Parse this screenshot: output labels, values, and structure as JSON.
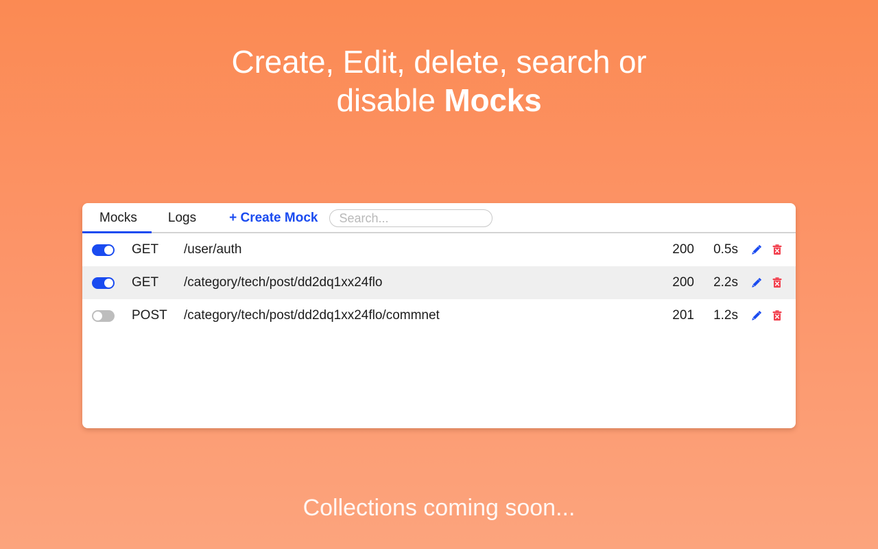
{
  "hero": {
    "line1": "Create, Edit, delete, search or",
    "line2_prefix": "disable ",
    "line2_strong": "Mocks"
  },
  "card": {
    "tabs": [
      {
        "label": "Mocks",
        "active": true
      },
      {
        "label": "Logs",
        "active": false
      }
    ],
    "create_label": "+ Create Mock",
    "search": {
      "placeholder": "Search...",
      "value": ""
    },
    "rows": [
      {
        "enabled": true,
        "method": "GET",
        "path": "/user/auth",
        "status": "200",
        "latency": "0.5s",
        "edit_icon": "pencil-icon",
        "delete_icon": "trash-icon"
      },
      {
        "enabled": true,
        "method": "GET",
        "path": "/category/tech/post/dd2dq1xx24flo",
        "status": "200",
        "latency": "2.2s",
        "edit_icon": "pencil-icon",
        "delete_icon": "trash-icon"
      },
      {
        "enabled": false,
        "method": "POST",
        "path": "/category/tech/post/dd2dq1xx24flo/commnet",
        "status": "201",
        "latency": "1.2s",
        "edit_icon": "pencil-icon",
        "delete_icon": "trash-icon"
      }
    ]
  },
  "footer": {
    "text": "Collections coming soon..."
  },
  "colors": {
    "background_top": "#FB8A53",
    "background_bottom": "#FCA47D",
    "accent_blue": "#1A4BF0",
    "delete_red": "#F2404E",
    "row_alt": "#EFEFEF",
    "card_white": "#FFFFFF"
  }
}
